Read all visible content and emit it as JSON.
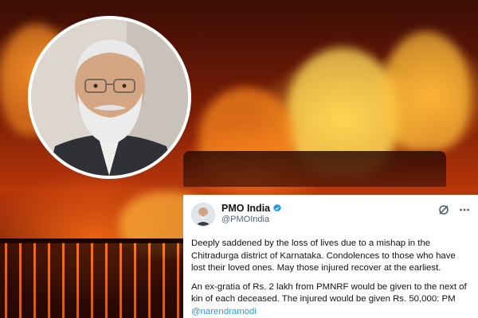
{
  "tweet": {
    "display_name": "PMO India",
    "handle": "@PMOIndia",
    "paragraph1": "Deeply saddened by the loss of lives due to a mishap in the Chitradurga district of Karnataka. Condolences to those who have lost their loved ones. May those injured recover at the earliest.",
    "paragraph2": "An ex-gratia of Rs. 2 lakh from PMNRF would be given to the next of kin of each deceased. The injured would be given Rs. 50,000: PM",
    "mention": "@narendramodi",
    "verified_icon": "verified-badge-icon",
    "grok_icon": "grok-icon",
    "more_icon": "more-options-icon"
  },
  "colors": {
    "link": "#1d9bf0",
    "verified": "#1d9bf0",
    "fire": "#ff7a1a"
  }
}
